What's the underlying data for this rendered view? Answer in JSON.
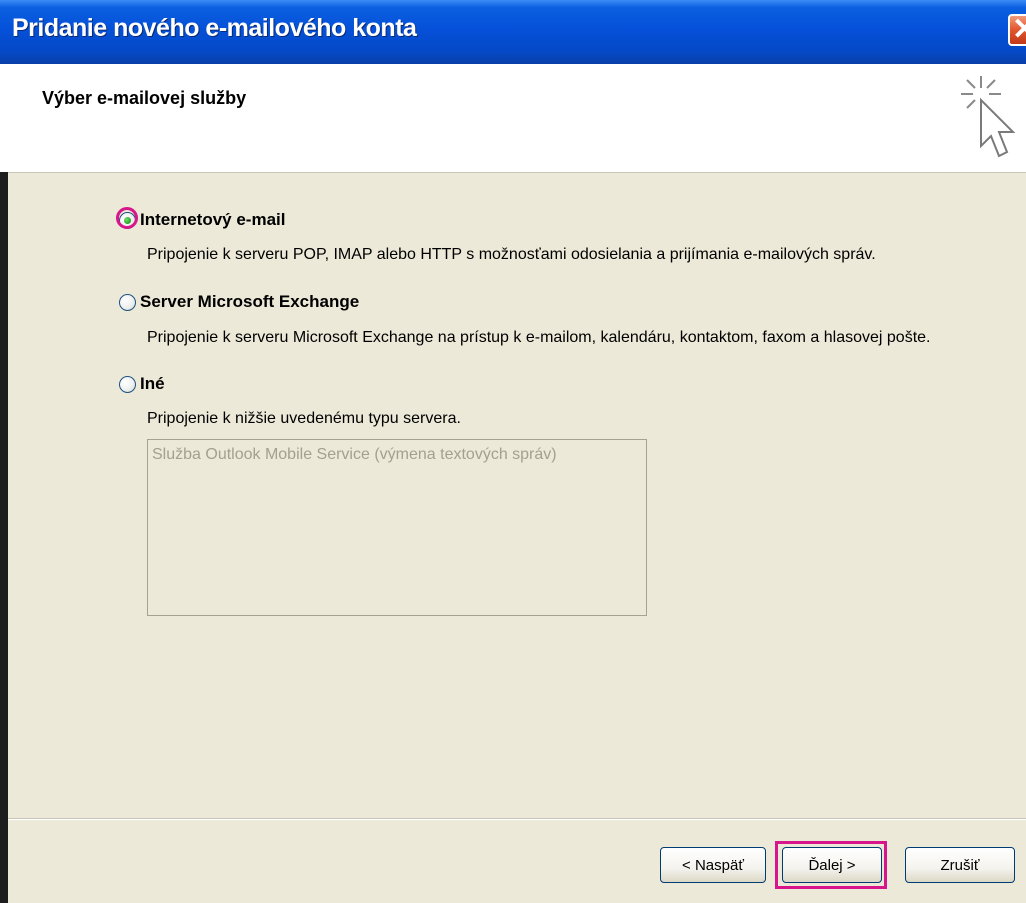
{
  "window": {
    "title": "Pridanie nového e-mailového konta",
    "close_icon": "close-icon"
  },
  "header": {
    "title": "Výber e-mailovej služby",
    "icon": "wizard-cursor-icon"
  },
  "options": [
    {
      "label": "Internetový e-mail",
      "description": "Pripojenie k serveru POP, IMAP alebo HTTP s možnosťami odosielania a prijímania e-mailových správ.",
      "selected": true
    },
    {
      "label": "Server Microsoft Exchange",
      "description": "Pripojenie k serveru Microsoft Exchange na prístup k e-mailom, kalendáru, kontaktom, faxom a hlasovej pošte.",
      "selected": false
    },
    {
      "label": "Iné",
      "description": "Pripojenie k nižšie uvedenému typu servera.",
      "selected": false
    }
  ],
  "server_list": {
    "items": [
      "Služba Outlook Mobile Service (výmena textových správ)"
    ],
    "disabled": true
  },
  "buttons": {
    "back": "< Naspäť",
    "next": "Ďalej >",
    "cancel": "Zrušiť"
  },
  "colors": {
    "titlebar": "#0551d9",
    "dialog_bg": "#ece9d8",
    "highlight": "#d6168a",
    "close_button": "#e2552d"
  }
}
